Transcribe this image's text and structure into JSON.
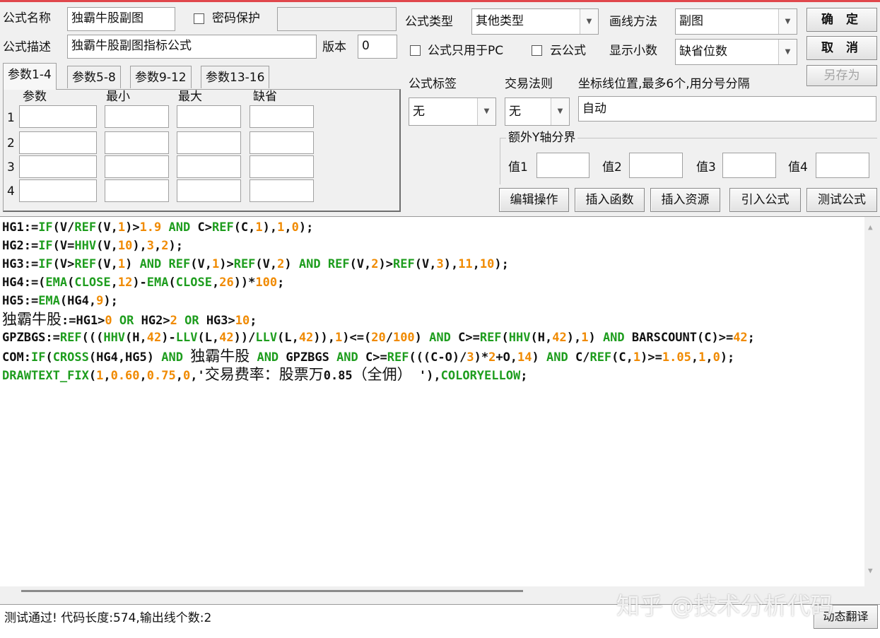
{
  "header": {
    "name_label": "公式名称",
    "name_value": "独霸牛股副图",
    "password_label": "密码保护",
    "password_value": "",
    "desc_label": "公式描述",
    "desc_value": "独霸牛股副图指标公式",
    "version_label": "版本",
    "version_value": "0",
    "type_label": "公式类型",
    "type_value": "其他类型",
    "draw_label": "画线方法",
    "draw_value": "副图",
    "pc_only_label": "公式只用于PC",
    "cloud_label": "云公式",
    "decimal_label": "显示小数",
    "decimal_value": "缺省位数"
  },
  "buttons": {
    "ok": "确 定",
    "cancel": "取 消",
    "save_as": "另存为",
    "edit_ops": "编辑操作",
    "insert_func": "插入函数",
    "insert_res": "插入资源",
    "import_formula": "引入公式",
    "test_formula": "测试公式",
    "dynamic_translate": "动态翻译"
  },
  "params": {
    "tabs": [
      "参数1-4",
      "参数5-8",
      "参数9-12",
      "参数13-16"
    ],
    "columns": [
      "参数",
      "最小",
      "最大",
      "缺省"
    ],
    "rows": [
      "1",
      "2",
      "3",
      "4"
    ]
  },
  "options": {
    "tag_label": "公式标签",
    "tag_value": "无",
    "rule_label": "交易法则",
    "rule_value": "无",
    "coord_label": "坐标线位置,最多6个,用分号分隔",
    "coord_value": "自动",
    "extra_y_label": "额外Y轴分界",
    "val_labels": [
      "值1",
      "值2",
      "值3",
      "值4"
    ]
  },
  "code_lines": [
    [
      [
        "plain",
        "HG1:="
      ],
      [
        "kw",
        "IF"
      ],
      [
        "plain",
        "(V/"
      ],
      [
        "kw",
        "REF"
      ],
      [
        "plain",
        "(V,"
      ],
      [
        "num",
        "1"
      ],
      [
        "plain",
        ")>"
      ],
      [
        "num",
        "1.9"
      ],
      [
        "plain",
        " "
      ],
      [
        "kw",
        "AND"
      ],
      [
        "plain",
        " C>"
      ],
      [
        "kw",
        "REF"
      ],
      [
        "plain",
        "(C,"
      ],
      [
        "num",
        "1"
      ],
      [
        "plain",
        "),"
      ],
      [
        "num",
        "1"
      ],
      [
        "plain",
        ","
      ],
      [
        "num",
        "0"
      ],
      [
        "plain",
        ");"
      ]
    ],
    [
      [
        "plain",
        "HG2:="
      ],
      [
        "kw",
        "IF"
      ],
      [
        "plain",
        "(V="
      ],
      [
        "kw",
        "HHV"
      ],
      [
        "plain",
        "(V,"
      ],
      [
        "num",
        "10"
      ],
      [
        "plain",
        "),"
      ],
      [
        "num",
        "3"
      ],
      [
        "plain",
        ","
      ],
      [
        "num",
        "2"
      ],
      [
        "plain",
        ");"
      ]
    ],
    [
      [
        "plain",
        "HG3:="
      ],
      [
        "kw",
        "IF"
      ],
      [
        "plain",
        "(V>"
      ],
      [
        "kw",
        "REF"
      ],
      [
        "plain",
        "(V,"
      ],
      [
        "num",
        "1"
      ],
      [
        "plain",
        ") "
      ],
      [
        "kw",
        "AND"
      ],
      [
        "plain",
        " "
      ],
      [
        "kw",
        "REF"
      ],
      [
        "plain",
        "(V,"
      ],
      [
        "num",
        "1"
      ],
      [
        "plain",
        ")>"
      ],
      [
        "kw",
        "REF"
      ],
      [
        "plain",
        "(V,"
      ],
      [
        "num",
        "2"
      ],
      [
        "plain",
        ") "
      ],
      [
        "kw",
        "AND"
      ],
      [
        "plain",
        " "
      ],
      [
        "kw",
        "REF"
      ],
      [
        "plain",
        "(V,"
      ],
      [
        "num",
        "2"
      ],
      [
        "plain",
        ")>"
      ],
      [
        "kw",
        "REF"
      ],
      [
        "plain",
        "(V,"
      ],
      [
        "num",
        "3"
      ],
      [
        "plain",
        "),"
      ],
      [
        "num",
        "11"
      ],
      [
        "plain",
        ","
      ],
      [
        "num",
        "10"
      ],
      [
        "plain",
        ");"
      ]
    ],
    [
      [
        "plain",
        "HG4:=("
      ],
      [
        "kw",
        "EMA"
      ],
      [
        "plain",
        "("
      ],
      [
        "kw",
        "CLOSE"
      ],
      [
        "plain",
        ","
      ],
      [
        "num",
        "12"
      ],
      [
        "plain",
        ")-"
      ],
      [
        "kw",
        "EMA"
      ],
      [
        "plain",
        "("
      ],
      [
        "kw",
        "CLOSE"
      ],
      [
        "plain",
        ","
      ],
      [
        "num",
        "26"
      ],
      [
        "plain",
        "))*"
      ],
      [
        "num",
        "100"
      ],
      [
        "plain",
        ";"
      ]
    ],
    [
      [
        "plain",
        "HG5:="
      ],
      [
        "kw",
        "EMA"
      ],
      [
        "plain",
        "(HG4,"
      ],
      [
        "num",
        "9"
      ],
      [
        "plain",
        ");"
      ]
    ],
    [
      [
        "cjk",
        "独霸牛股"
      ],
      [
        "plain",
        ":=HG1>"
      ],
      [
        "num",
        "0"
      ],
      [
        "plain",
        " "
      ],
      [
        "kw",
        "OR"
      ],
      [
        "plain",
        " HG2>"
      ],
      [
        "num",
        "2"
      ],
      [
        "plain",
        " "
      ],
      [
        "kw",
        "OR"
      ],
      [
        "plain",
        " HG3>"
      ],
      [
        "num",
        "10"
      ],
      [
        "plain",
        ";"
      ]
    ],
    [
      [
        "plain",
        "GPZBGS:="
      ],
      [
        "kw",
        "REF"
      ],
      [
        "plain",
        "((("
      ],
      [
        "kw",
        "HHV"
      ],
      [
        "plain",
        "(H,"
      ],
      [
        "num",
        "42"
      ],
      [
        "plain",
        ")-"
      ],
      [
        "kw",
        "LLV"
      ],
      [
        "plain",
        "(L,"
      ],
      [
        "num",
        "42"
      ],
      [
        "plain",
        "))/"
      ],
      [
        "kw",
        "LLV"
      ],
      [
        "plain",
        "(L,"
      ],
      [
        "num",
        "42"
      ],
      [
        "plain",
        ")),"
      ],
      [
        "num",
        "1"
      ],
      [
        "plain",
        ")<=("
      ],
      [
        "num",
        "20"
      ],
      [
        "plain",
        "/"
      ],
      [
        "num",
        "100"
      ],
      [
        "plain",
        ") "
      ],
      [
        "kw",
        "AND"
      ],
      [
        "plain",
        " C>="
      ],
      [
        "kw",
        "REF"
      ],
      [
        "plain",
        "("
      ],
      [
        "kw",
        "HHV"
      ],
      [
        "plain",
        "(H,"
      ],
      [
        "num",
        "42"
      ],
      [
        "plain",
        "),"
      ],
      [
        "num",
        "1"
      ],
      [
        "plain",
        ") "
      ],
      [
        "kw",
        "AND"
      ],
      [
        "plain",
        " BARSCOUNT(C)>="
      ],
      [
        "num",
        "42"
      ],
      [
        "plain",
        ";"
      ]
    ],
    [
      [
        "plain",
        "COM:"
      ],
      [
        "kw",
        "IF"
      ],
      [
        "plain",
        "("
      ],
      [
        "kw",
        "CROSS"
      ],
      [
        "plain",
        "(HG4,HG5) "
      ],
      [
        "kw",
        "AND"
      ],
      [
        "plain",
        " "
      ],
      [
        "cjk",
        "独霸牛股"
      ],
      [
        "plain",
        " "
      ],
      [
        "kw",
        "AND"
      ],
      [
        "plain",
        " GPZBGS "
      ],
      [
        "kw",
        "AND"
      ],
      [
        "plain",
        " C>="
      ],
      [
        "kw",
        "REF"
      ],
      [
        "plain",
        "(((C-O)/"
      ],
      [
        "num",
        "3"
      ],
      [
        "plain",
        ")*"
      ],
      [
        "num",
        "2"
      ],
      [
        "plain",
        "+O,"
      ],
      [
        "num",
        "14"
      ],
      [
        "plain",
        ") "
      ],
      [
        "kw",
        "AND"
      ],
      [
        "plain",
        " C/"
      ],
      [
        "kw",
        "REF"
      ],
      [
        "plain",
        "(C,"
      ],
      [
        "num",
        "1"
      ],
      [
        "plain",
        ")>="
      ],
      [
        "num",
        "1.05"
      ],
      [
        "plain",
        ","
      ],
      [
        "num",
        "1"
      ],
      [
        "plain",
        ","
      ],
      [
        "num",
        "0"
      ],
      [
        "plain",
        ");"
      ]
    ],
    [
      [
        "kw",
        "DRAWTEXT_FIX"
      ],
      [
        "plain",
        "("
      ],
      [
        "num",
        "1"
      ],
      [
        "plain",
        ","
      ],
      [
        "num",
        "0.60"
      ],
      [
        "plain",
        ","
      ],
      [
        "num",
        "0.75"
      ],
      [
        "plain",
        ","
      ],
      [
        "num",
        "0"
      ],
      [
        "plain",
        ",'"
      ],
      [
        "cjk",
        "交易费率：股票万"
      ],
      [
        "plain",
        "0.85"
      ],
      [
        "cjk",
        "（全佣）"
      ],
      [
        "plain",
        " '),"
      ],
      [
        "kw",
        "COLORYELLOW"
      ],
      [
        "plain",
        ";"
      ]
    ]
  ],
  "status": {
    "message": "测试通过! 代码长度:574,输出线个数:2"
  },
  "watermark": "知乎 @技术分析代码"
}
